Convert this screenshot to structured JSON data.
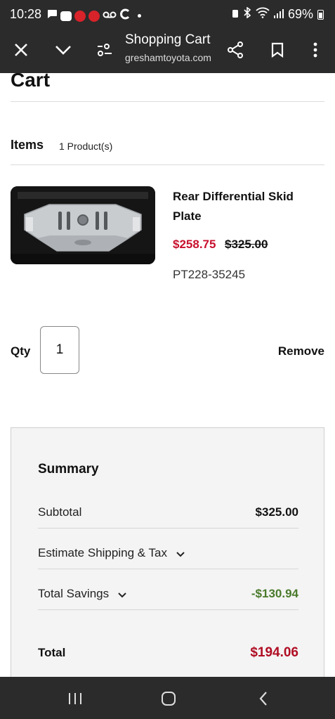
{
  "status_bar": {
    "time": "10:28",
    "battery": "69%",
    "icons": [
      "chat-icon",
      "n-app-icon",
      "red-app-icon",
      "red-app-icon",
      "voicemail-icon",
      "c-app-icon",
      "dot-icon",
      "battery-saver-icon",
      "bluetooth-icon",
      "wifi-icon",
      "signal-icon",
      "battery-icon"
    ]
  },
  "toolbar": {
    "title": "Shopping Cart",
    "url": "greshamtoyota.com",
    "buttons": [
      "close-icon",
      "chevron-down-icon",
      "page-settings-icon",
      "share-icon",
      "bookmark-icon",
      "more-vert-icon"
    ]
  },
  "cart": {
    "heading": "Cart",
    "items_label": "Items",
    "items_count": "1 Product(s)"
  },
  "product": {
    "name": "Rear Differential Skid Plate",
    "sale_price": "$258.75",
    "original_price": "$325.00",
    "part_number": "PT228-35245",
    "qty_label": "Qty",
    "qty_value": "1",
    "remove_label": "Remove"
  },
  "summary": {
    "title": "Summary",
    "subtotal_label": "Subtotal",
    "subtotal_value": "$325.00",
    "shipping_label": "Estimate Shipping & Tax",
    "savings_label": "Total Savings",
    "savings_value": "-$130.94",
    "total_label": "Total",
    "total_value": "$194.06"
  },
  "colors": {
    "sale": "#c8102e",
    "savings": "#4a7a2c",
    "total": "#b00d23",
    "chrome": "#2b2b2b"
  }
}
